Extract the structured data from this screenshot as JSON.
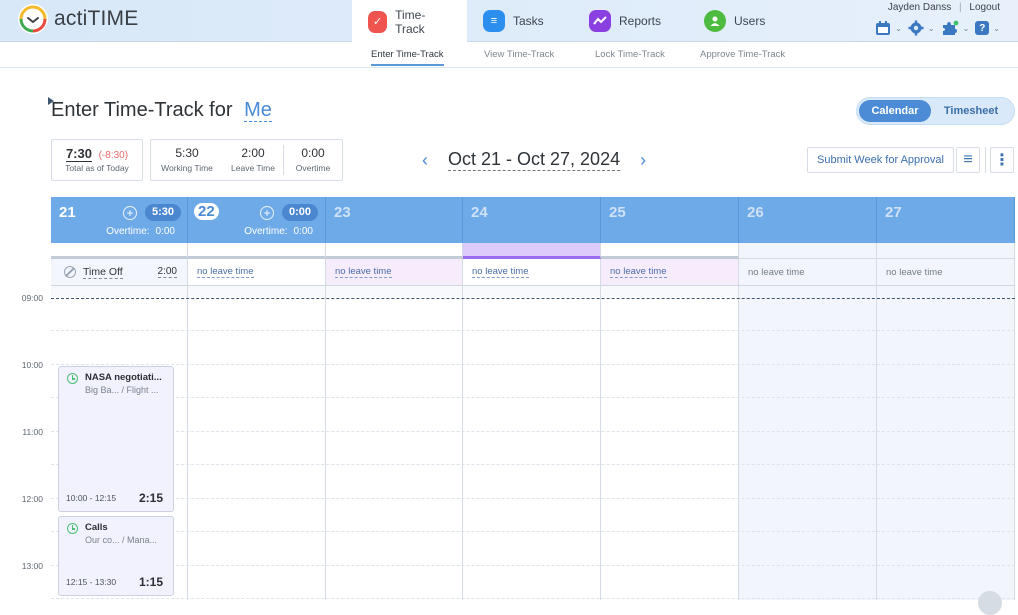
{
  "app": {
    "name": "actiTIME",
    "logo_icon": "clock-logo-icon"
  },
  "header": {
    "tabs": [
      {
        "label": "Time-Track",
        "icon": "checkmark-icon",
        "color": "#f0544f",
        "active": true
      },
      {
        "label": "Tasks",
        "icon": "list-icon",
        "color": "#2c8ff0",
        "active": false
      },
      {
        "label": "Reports",
        "icon": "chart-line-icon",
        "color": "#8a3fe0",
        "active": false
      },
      {
        "label": "Users",
        "icon": "user-icon",
        "color": "#4dbb3f",
        "active": false
      }
    ],
    "user_name": "Jayden Danss",
    "separator": "|",
    "logout_label": "Logout",
    "tools": [
      {
        "icon": "calendar-icon"
      },
      {
        "icon": "gear-icon"
      },
      {
        "icon": "puzzle-icon"
      },
      {
        "icon": "help-icon",
        "glyph": "?"
      }
    ]
  },
  "subnav": {
    "items": [
      {
        "label": "Enter Time-Track",
        "active": true
      },
      {
        "label": "View Time-Track",
        "active": false
      },
      {
        "label": "Lock Time-Track",
        "active": false
      },
      {
        "label": "Approve Time-Track",
        "active": false
      }
    ]
  },
  "page": {
    "title_prefix": "Enter Time-Track for",
    "title_user": "Me",
    "view_toggle": {
      "calendar": "Calendar",
      "timesheet": "Timesheet",
      "selected": "Calendar"
    },
    "total": {
      "value": "7:30",
      "delta": "(-8:30)",
      "label": "Total as of Today"
    },
    "stats": [
      {
        "value": "5:30",
        "label": "Working Time"
      },
      {
        "value": "2:00",
        "label": "Leave Time"
      },
      {
        "value": "0:00",
        "label": "Overtime"
      }
    ],
    "week_range": "Oct 21 - Oct 27, 2024",
    "prev_glyph": "‹",
    "next_glyph": "›",
    "submit_label": "Submit Week for Approval",
    "list_glyph": "≡",
    "more_glyph": "⋮"
  },
  "calendar": {
    "days": [
      {
        "num": "21",
        "total": "5:30",
        "overtime_label": "Overtime:",
        "overtime": "0:00",
        "leave": "Time Off",
        "leave_value": "2:00"
      },
      {
        "num": "22",
        "total": "0:00",
        "overtime_label": "Overtime:",
        "overtime": "0:00",
        "leave": "no leave time",
        "today": true
      },
      {
        "num": "23",
        "leave": "no leave time"
      },
      {
        "num": "24",
        "leave": "no leave time"
      },
      {
        "num": "25",
        "leave": "no leave time"
      },
      {
        "num": "26",
        "leave": "no leave time"
      },
      {
        "num": "27",
        "leave": "no leave time"
      }
    ],
    "plus_glyph": "+",
    "hours": [
      "09:00",
      "10:00",
      "11:00",
      "12:00",
      "13:00"
    ],
    "entries": [
      {
        "title": "NASA negotiati...",
        "subtitle": "Big Ba... / Flight ...",
        "range": "10:00 - 12:15",
        "duration": "2:15"
      },
      {
        "title": "Calls",
        "subtitle": "Our co... / Mana...",
        "range": "12:15 - 13:30",
        "duration": "1:15"
      }
    ]
  }
}
